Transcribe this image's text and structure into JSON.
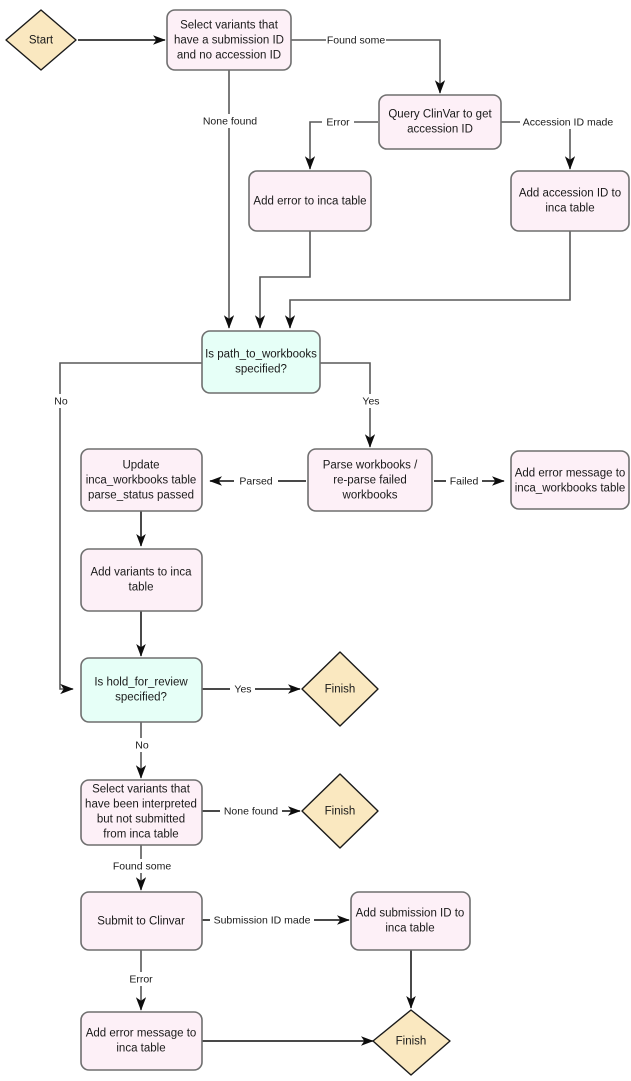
{
  "diagram": {
    "title": "ClinVar submission pipeline flowchart",
    "colors": {
      "process_fill": "#fdf0f7",
      "process_stroke": "#6f6f6f",
      "decision_fill": "#e6fff7",
      "decision_stroke": "#6f6f6f",
      "terminator_fill": "#fae8c0",
      "terminator_stroke": "#1a1a1a",
      "connector": "#595959",
      "connector_dark": "#0d0d0d",
      "text": "#1a1a1a",
      "background": "#ffffff"
    },
    "nodes": [
      {
        "id": "start",
        "type": "terminator",
        "lines": [
          "Start"
        ]
      },
      {
        "id": "select_variants",
        "type": "process",
        "lines": [
          "Select variants that",
          "have a submission ID",
          "and no accession ID"
        ]
      },
      {
        "id": "query_clinvar",
        "type": "process",
        "lines": [
          "Query ClinVar to get",
          "accession ID"
        ]
      },
      {
        "id": "add_error_inca",
        "type": "process",
        "lines": [
          "Add error to inca table"
        ]
      },
      {
        "id": "add_accession",
        "type": "process",
        "lines": [
          "Add accession ID to",
          "inca table"
        ]
      },
      {
        "id": "is_path",
        "type": "decision",
        "lines": [
          "Is path_to_workbooks",
          "specified?"
        ]
      },
      {
        "id": "update_wb",
        "type": "process",
        "lines": [
          "Update",
          "inca_workbooks table",
          "parse_status passed"
        ]
      },
      {
        "id": "parse_wb",
        "type": "process",
        "lines": [
          "Parse workbooks /",
          "re-parse failed",
          "workbooks"
        ]
      },
      {
        "id": "add_err_wb",
        "type": "process",
        "lines": [
          "Add error message to",
          "inca_workbooks table"
        ]
      },
      {
        "id": "add_variants",
        "type": "process",
        "lines": [
          "Add variants to inca",
          "table"
        ]
      },
      {
        "id": "is_hold",
        "type": "decision",
        "lines": [
          "Is hold_for_review",
          "specified?"
        ]
      },
      {
        "id": "finish_hold",
        "type": "terminator",
        "lines": [
          "Finish"
        ]
      },
      {
        "id": "select_interp",
        "type": "process",
        "lines": [
          "Select variants that",
          "have been interpreted",
          "but not submitted",
          "from inca table"
        ]
      },
      {
        "id": "finish_none",
        "type": "terminator",
        "lines": [
          "Finish"
        ]
      },
      {
        "id": "submit_clinvar",
        "type": "process",
        "lines": [
          "Submit to Clinvar"
        ]
      },
      {
        "id": "add_submission",
        "type": "process",
        "lines": [
          "Add submission ID to",
          "inca table"
        ]
      },
      {
        "id": "add_err_inca2",
        "type": "process",
        "lines": [
          "Add error message to",
          "inca table"
        ]
      },
      {
        "id": "finish_end",
        "type": "terminator",
        "lines": [
          "Finish"
        ]
      }
    ],
    "edge_labels": [
      {
        "id": "found_some_1",
        "text": "Found some"
      },
      {
        "id": "none_found_1",
        "text": "None found"
      },
      {
        "id": "error_1",
        "text": "Error"
      },
      {
        "id": "accession_made",
        "text": "Accession ID made"
      },
      {
        "id": "no_1",
        "text": "No"
      },
      {
        "id": "yes_1",
        "text": "Yes"
      },
      {
        "id": "parsed",
        "text": "Parsed"
      },
      {
        "id": "failed",
        "text": "Failed"
      },
      {
        "id": "yes_2",
        "text": "Yes"
      },
      {
        "id": "no_2",
        "text": "No"
      },
      {
        "id": "none_found_2",
        "text": "None found"
      },
      {
        "id": "found_some_2",
        "text": "Found some"
      },
      {
        "id": "submission_made",
        "text": "Submission ID made"
      },
      {
        "id": "error_2",
        "text": "Error"
      }
    ]
  },
  "nodes": {
    "start": {
      "l0": "Start"
    },
    "select_variants": {
      "l0": "Select variants that",
      "l1": "have a submission ID",
      "l2": "and no accession ID"
    },
    "query_clinvar": {
      "l0": "Query ClinVar to get",
      "l1": "accession ID"
    },
    "add_error_inca": {
      "l0": "Add error to inca table"
    },
    "add_accession": {
      "l0": "Add accession ID to",
      "l1": "inca table"
    },
    "is_path": {
      "l0": "Is path_to_workbooks",
      "l1": "specified?"
    },
    "update_wb": {
      "l0": "Update",
      "l1": "inca_workbooks table",
      "l2": "parse_status passed"
    },
    "parse_wb": {
      "l0": "Parse workbooks /",
      "l1": "re-parse failed",
      "l2": "workbooks"
    },
    "add_err_wb": {
      "l0": "Add error message to",
      "l1": "inca_workbooks table"
    },
    "add_variants": {
      "l0": "Add variants to inca",
      "l1": "table"
    },
    "is_hold": {
      "l0": "Is hold_for_review",
      "l1": "specified?"
    },
    "finish_hold": {
      "l0": "Finish"
    },
    "select_interp": {
      "l0": "Select variants that",
      "l1": "have been interpreted",
      "l2": "but not submitted",
      "l3": "from inca table"
    },
    "finish_none": {
      "l0": "Finish"
    },
    "submit_clinvar": {
      "l0": "Submit to Clinvar"
    },
    "add_submission": {
      "l0": "Add submission ID to",
      "l1": "inca table"
    },
    "add_err_inca2": {
      "l0": "Add error message to",
      "l1": "inca table"
    },
    "finish_end": {
      "l0": "Finish"
    }
  },
  "labels": {
    "found_some_1": "Found some",
    "none_found_1": "None found",
    "error_1": "Error",
    "accession_made": "Accession ID made",
    "no_1": "No",
    "yes_1": "Yes",
    "parsed": "Parsed",
    "failed": "Failed",
    "yes_2": "Yes",
    "no_2": "No",
    "none_found_2": "None found",
    "found_some_2": "Found some",
    "submission_made": "Submission ID made",
    "error_2": "Error"
  }
}
